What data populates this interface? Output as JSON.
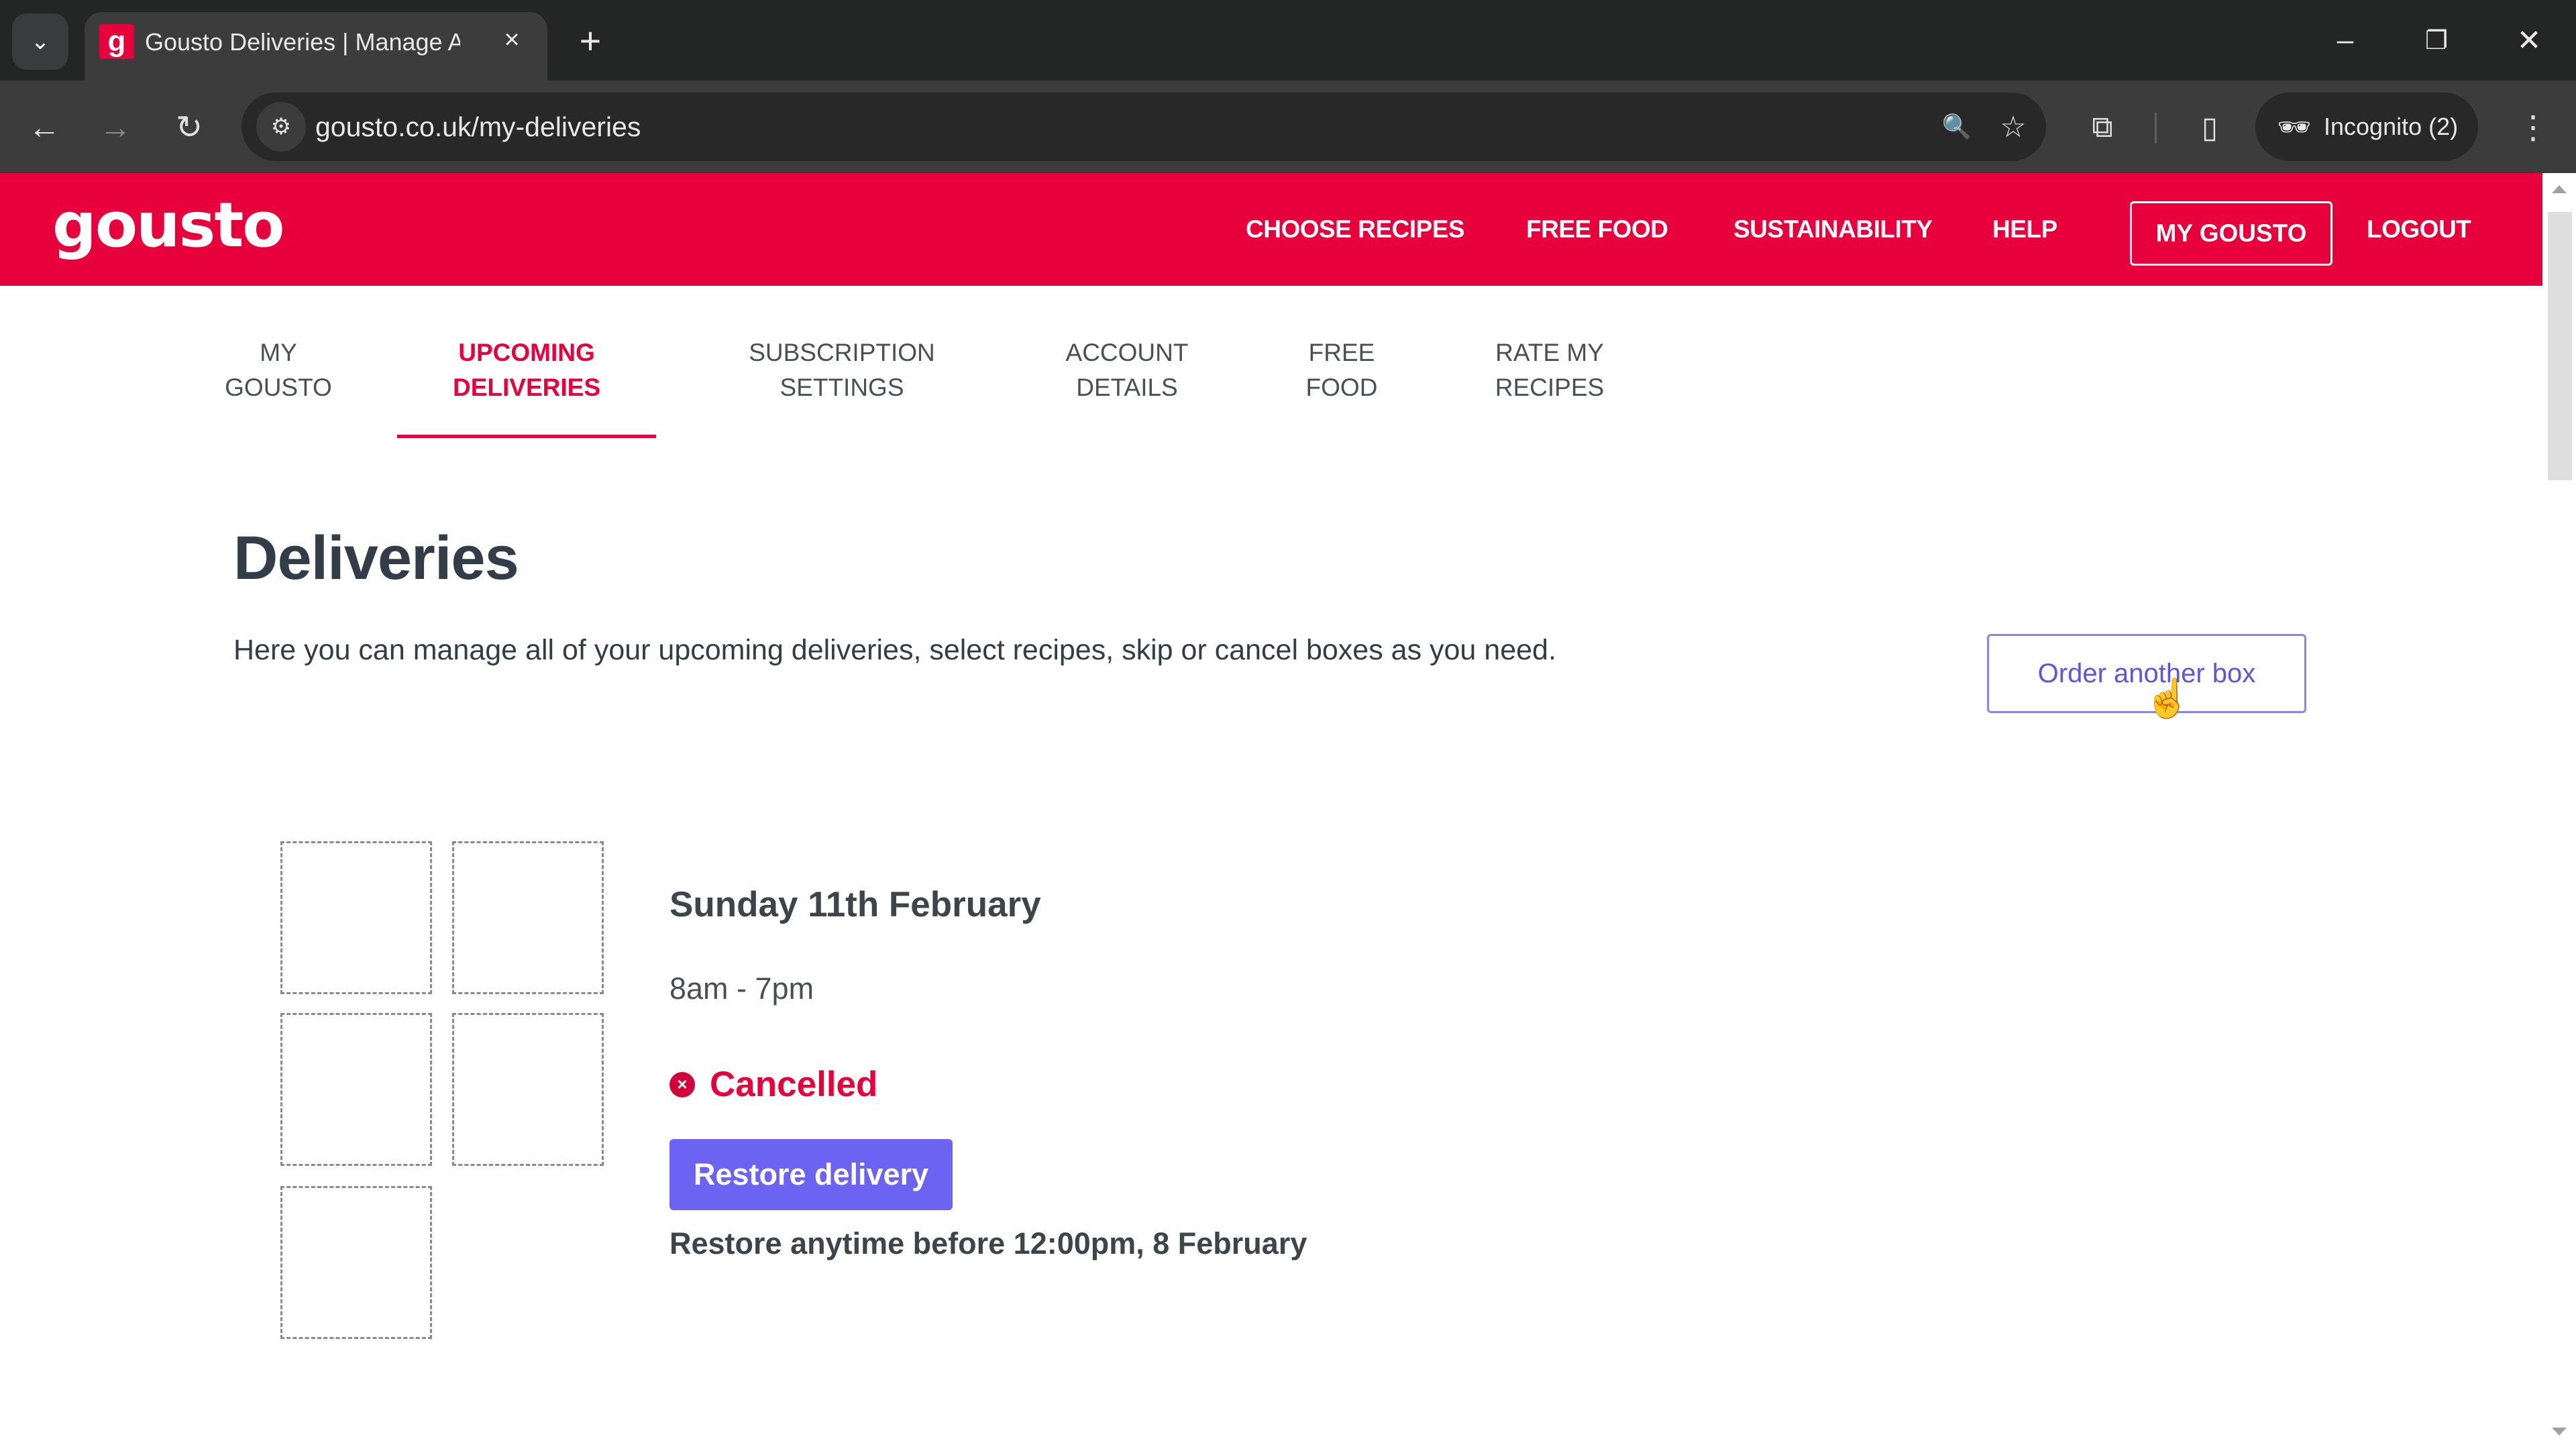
{
  "browser": {
    "tab": {
      "favicon": "g",
      "title": "Gousto Deliveries | Manage All",
      "close_label": "×"
    },
    "new_tab_label": "+",
    "window_controls": {
      "minimize": "–",
      "restore": "❐",
      "close": "✕"
    },
    "nav": {
      "back": "←",
      "forward": "→",
      "reload": "↻"
    },
    "url": "gousto.co.uk/my-deliveries",
    "omnibox_icons": {
      "site_info": "⚙",
      "zoom": "🔍",
      "bookmark": "☆"
    },
    "toolbar_icons": {
      "extensions": "⧉",
      "side_panel": "▯",
      "menu": "⋮"
    },
    "incognito": {
      "icon": "🕶",
      "label": "Incognito (2)"
    }
  },
  "site": {
    "logo": "gousto",
    "header_nav": [
      {
        "label": "CHOOSE RECIPES"
      },
      {
        "label": "FREE FOOD"
      },
      {
        "label": "SUSTAINABILITY"
      },
      {
        "label": "HELP"
      },
      {
        "label": "MY GOUSTO"
      },
      {
        "label": "LOGOUT"
      }
    ],
    "sub_nav": [
      {
        "line1": "MY",
        "line2": "GOUSTO",
        "active": false
      },
      {
        "line1": "UPCOMING",
        "line2": "DELIVERIES",
        "active": true
      },
      {
        "line1": "SUBSCRIPTION",
        "line2": "SETTINGS",
        "active": false
      },
      {
        "line1": "ACCOUNT",
        "line2": "DETAILS",
        "active": false
      },
      {
        "line1": "FREE",
        "line2": "FOOD",
        "active": false
      },
      {
        "line1": "RATE MY",
        "line2": "RECIPES",
        "active": false
      }
    ]
  },
  "page": {
    "title": "Deliveries",
    "description": "Here you can manage all of your upcoming deliveries, select recipes, skip or cancel boxes as you need.",
    "order_button": "Order another box"
  },
  "delivery": {
    "recipe_placeholders": 5,
    "date": "Sunday 11th February",
    "time_window": "8am - 7pm",
    "status": "Cancelled",
    "status_icon": "×",
    "restore_button": "Restore delivery",
    "restore_note": "Restore anytime before 12:00pm, 8 February"
  },
  "colors": {
    "brand_red": "#e8003d",
    "accent_purple": "#6c63f3",
    "text_dark": "#333d47"
  }
}
